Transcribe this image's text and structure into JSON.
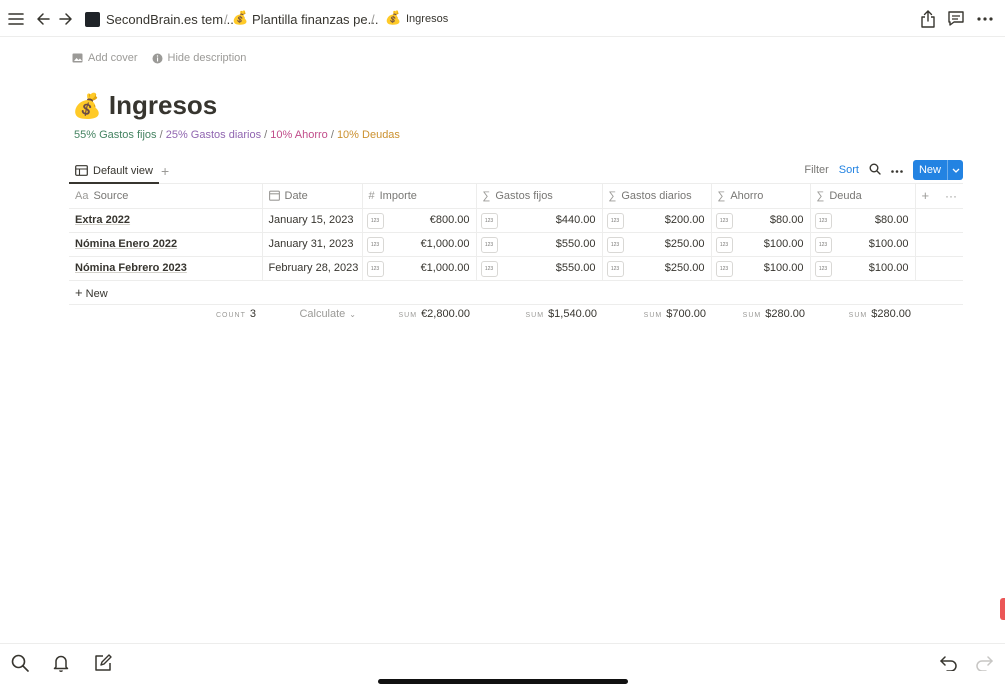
{
  "topbar": {
    "breadcrumbs": [
      {
        "label": "SecondBrain.es tem...",
        "icon": "secondbrain-logo"
      },
      {
        "label": "Plantilla finanzas pe...",
        "icon": "money-bag-emoji"
      },
      {
        "label": "Ingresos",
        "icon": "money-bag-emoji"
      }
    ],
    "separator": "/"
  },
  "page": {
    "add_cover": "Add cover",
    "hide_description": "Hide description",
    "emoji": "💰",
    "title": "Ingresos",
    "description": [
      {
        "text": "55% Gastos fijos",
        "color": "#448361"
      },
      {
        "text": " / ",
        "color": "#787774"
      },
      {
        "text": "25% Gastos diarios",
        "color": "#9065b0"
      },
      {
        "text": " / ",
        "color": "#787774"
      },
      {
        "text": "10% Ahorro",
        "color": "#c14c8a"
      },
      {
        "text": " / ",
        "color": "#787774"
      },
      {
        "text": "10% Deudas",
        "color": "#cb912f"
      }
    ]
  },
  "view": {
    "tab_label": "Default view",
    "filter": "Filter",
    "sort": "Sort",
    "new": "New"
  },
  "table": {
    "columns": [
      {
        "label": "Source",
        "icon": "Aa"
      },
      {
        "label": "Date",
        "icon": "calendar-icon"
      },
      {
        "label": "Importe",
        "icon": "#"
      },
      {
        "label": "Gastos fijos",
        "icon": "∑"
      },
      {
        "label": "Gastos diarios",
        "icon": "∑"
      },
      {
        "label": "Ahorro",
        "icon": "∑"
      },
      {
        "label": "Deuda",
        "icon": "∑"
      }
    ],
    "badge_text": "123",
    "rows": [
      {
        "source": "Extra 2022",
        "date": "January 15, 2023",
        "importe": "€800.00",
        "gastos_fijos": "$440.00",
        "gastos_diarios": "$200.00",
        "ahorro": "$80.00",
        "deuda": "$80.00"
      },
      {
        "source": "Nómina Enero 2022",
        "date": "January 31, 2023",
        "importe": "€1,000.00",
        "gastos_fijos": "$550.00",
        "gastos_diarios": "$250.00",
        "ahorro": "$100.00",
        "deuda": "$100.00"
      },
      {
        "source": "Nómina Febrero 2023",
        "date": "February 28, 2023",
        "importe": "€1,000.00",
        "gastos_fijos": "$550.00",
        "gastos_diarios": "$250.00",
        "ahorro": "$100.00",
        "deuda": "$100.00"
      }
    ],
    "new_row": "New",
    "footer": {
      "count_label": "COUNT",
      "count_value": "3",
      "calculate": "Calculate",
      "sum_label": "SUM",
      "importe_sum": "€2,800.00",
      "gastos_fijos_sum": "$1,540.00",
      "gastos_diarios_sum": "$700.00",
      "ahorro_sum": "$280.00",
      "deuda_sum": "$280.00"
    }
  }
}
